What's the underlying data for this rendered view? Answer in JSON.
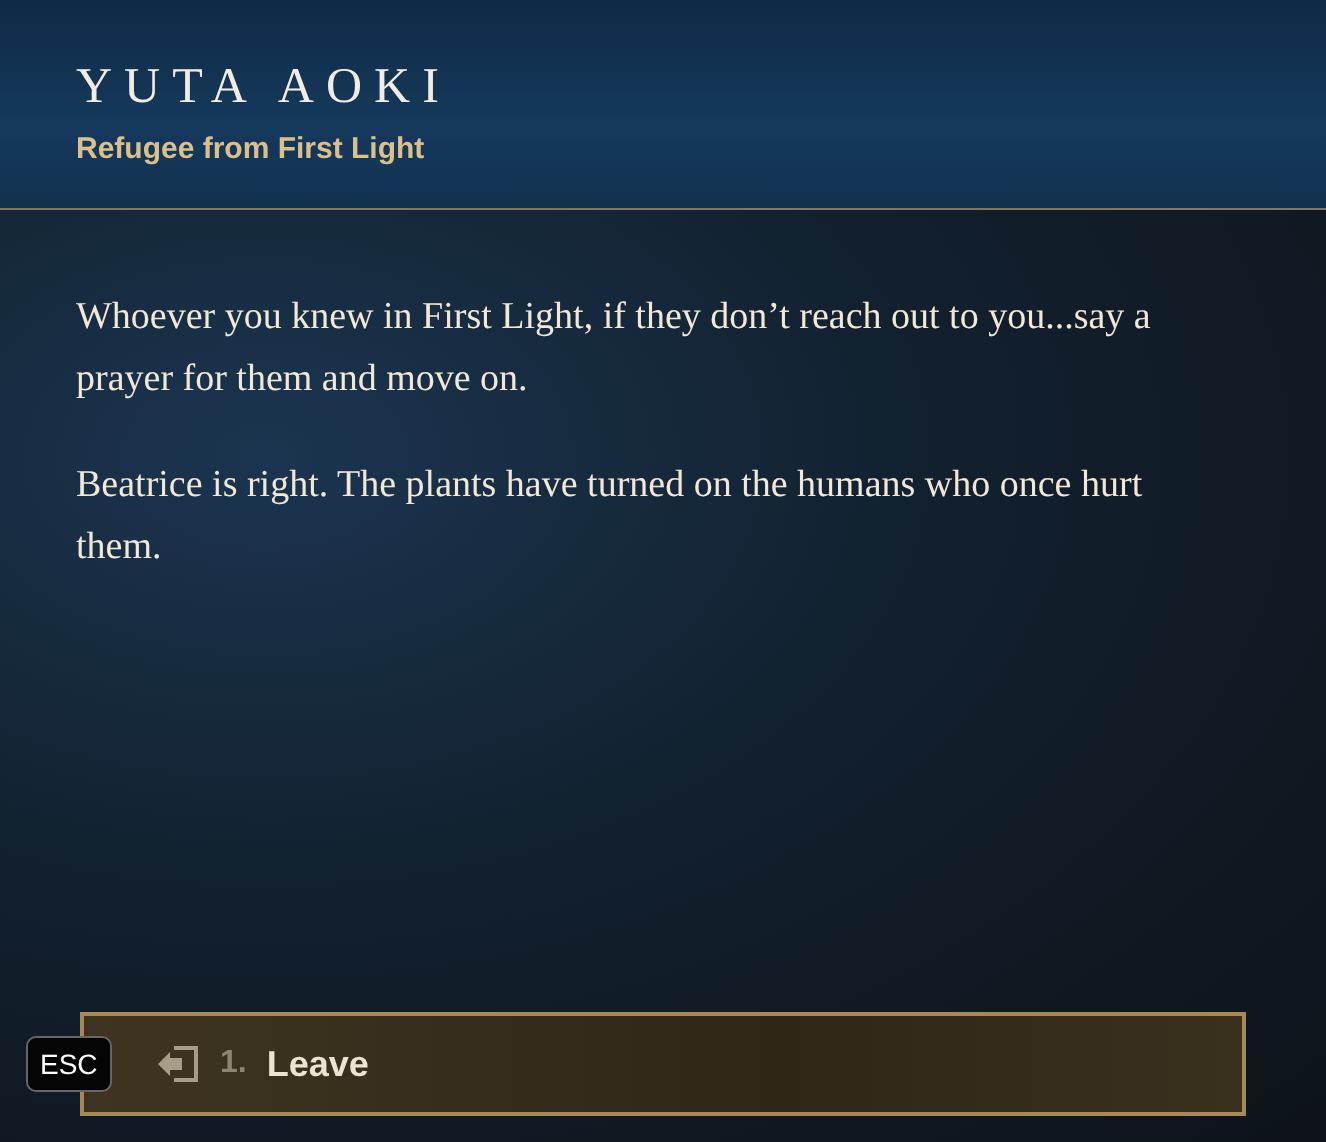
{
  "speaker": {
    "name": "YUTA AOKI",
    "title": "Refugee from First Light"
  },
  "paragraphs": [
    "Whoever you knew in First Light, if they don’t reach out to you...say a prayer for them and move on.",
    "Beatrice is right. The plants have turned on the humans who once hurt them."
  ],
  "options": [
    {
      "hotkey": "ESC",
      "number": "1.",
      "label": "Leave"
    }
  ]
}
